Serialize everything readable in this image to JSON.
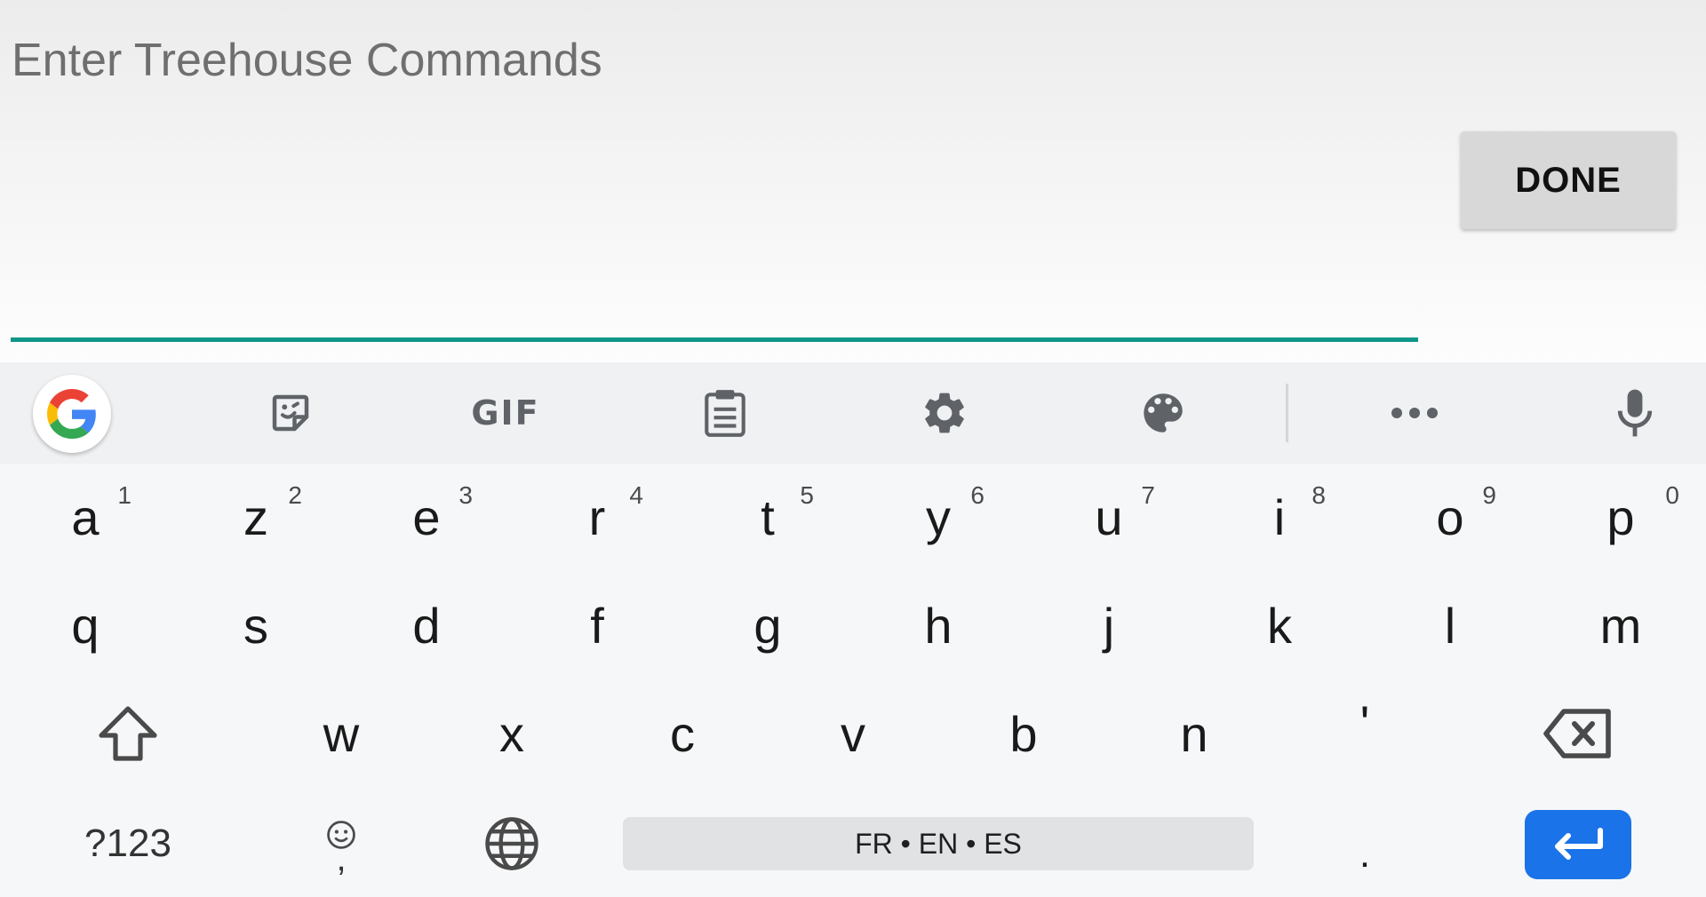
{
  "input": {
    "placeholder": "Enter Treehouse Commands",
    "value": "",
    "accent_color": "#0f9688"
  },
  "done_button": {
    "label": "DONE"
  },
  "toolbar": {
    "items": [
      {
        "icon": "google-g-icon"
      },
      {
        "icon": "sticker-icon"
      },
      {
        "icon": "gif-icon",
        "label": "GIF"
      },
      {
        "icon": "clipboard-icon"
      },
      {
        "icon": "gear-icon"
      },
      {
        "icon": "palette-icon"
      },
      {
        "icon": "more-horizontal-icon"
      },
      {
        "icon": "microphone-icon"
      }
    ]
  },
  "keyboard": {
    "row1": [
      {
        "letter": "a",
        "hint": "1"
      },
      {
        "letter": "z",
        "hint": "2"
      },
      {
        "letter": "e",
        "hint": "3"
      },
      {
        "letter": "r",
        "hint": "4"
      },
      {
        "letter": "t",
        "hint": "5"
      },
      {
        "letter": "y",
        "hint": "6"
      },
      {
        "letter": "u",
        "hint": "7"
      },
      {
        "letter": "i",
        "hint": "8"
      },
      {
        "letter": "o",
        "hint": "9"
      },
      {
        "letter": "p",
        "hint": "0"
      }
    ],
    "row2": [
      "q",
      "s",
      "d",
      "f",
      "g",
      "h",
      "j",
      "k",
      "l",
      "m"
    ],
    "row3": [
      "w",
      "x",
      "c",
      "v",
      "b",
      "n",
      "'"
    ],
    "symbols_label": "?123",
    "comma_label": ",",
    "space_label": "FR • EN • ES",
    "period_label": ".",
    "enter_color": "#1a73e8"
  }
}
